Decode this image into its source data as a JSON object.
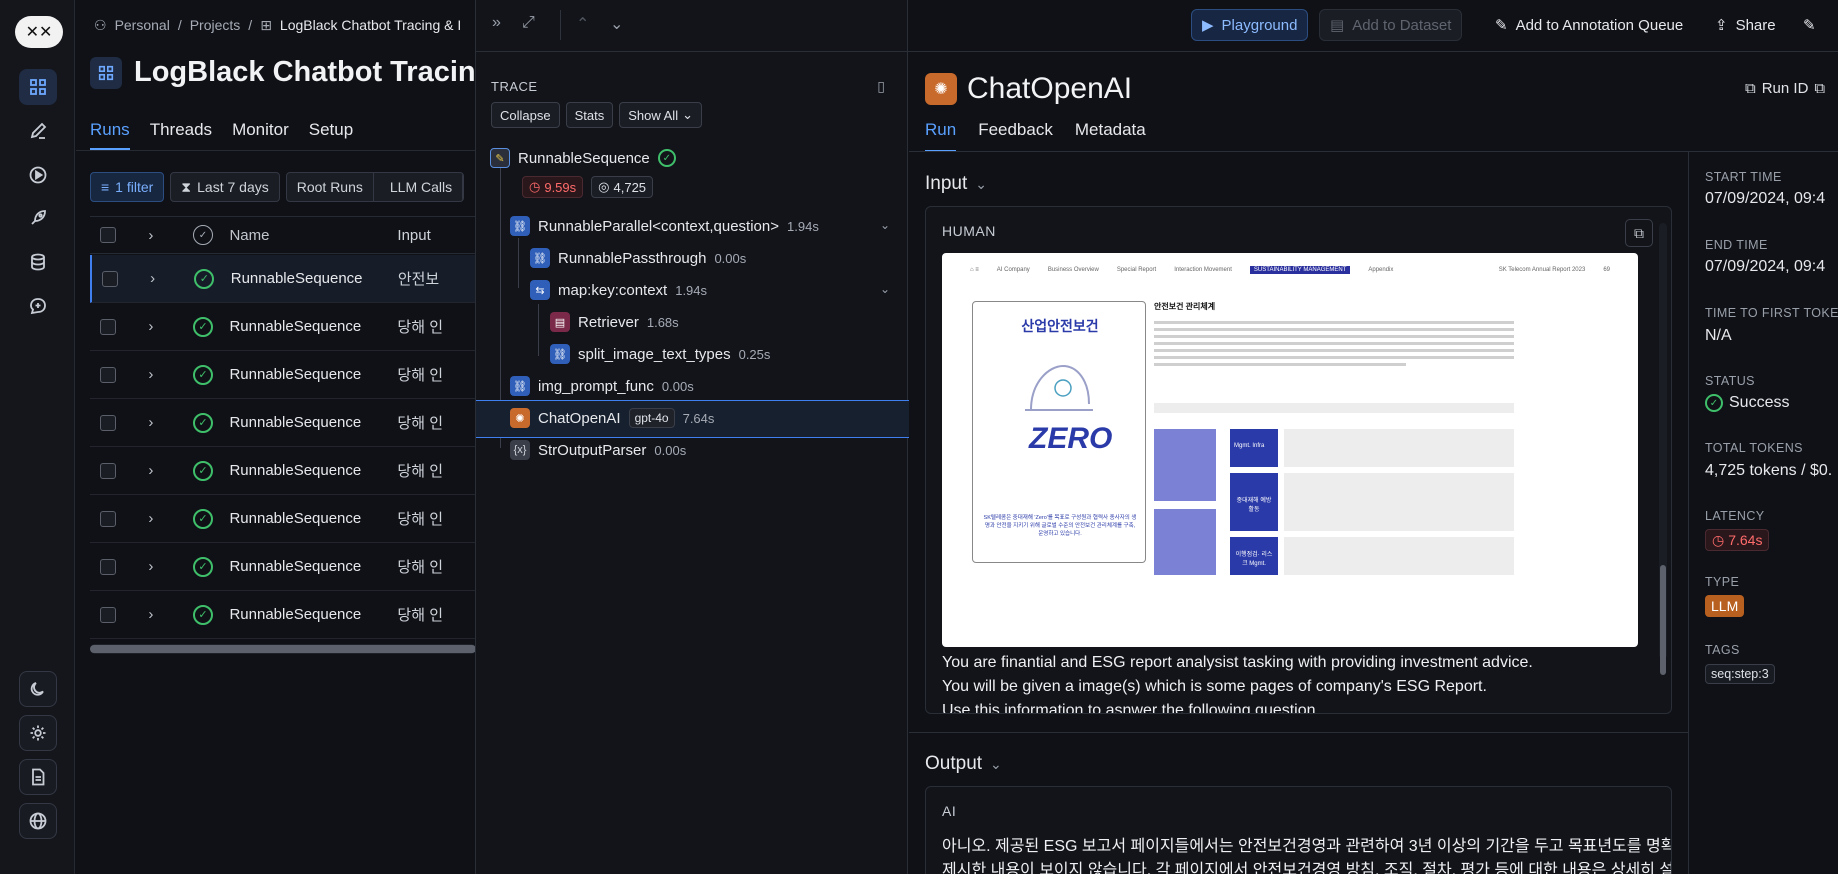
{
  "breadcrumb": {
    "personal": "Personal",
    "projects": "Projects",
    "current": "LogBlack Chatbot Tracing & I"
  },
  "page_title": "LogBlack Chatbot Tracin",
  "main_tabs": [
    "Runs",
    "Threads",
    "Monitor",
    "Setup"
  ],
  "filters": {
    "filter": "1 filter",
    "range": "Last 7 days",
    "root_runs": "Root Runs",
    "llm_calls": "LLM Calls"
  },
  "table": {
    "headers": {
      "name": "Name",
      "input": "Input"
    },
    "rows": [
      {
        "name": "RunnableSequence",
        "input": "안전보"
      },
      {
        "name": "RunnableSequence",
        "input": "당해 인"
      },
      {
        "name": "RunnableSequence",
        "input": "당해 인"
      },
      {
        "name": "RunnableSequence",
        "input": "당해 인"
      },
      {
        "name": "RunnableSequence",
        "input": "당해 인"
      },
      {
        "name": "RunnableSequence",
        "input": "당해 인"
      },
      {
        "name": "RunnableSequence",
        "input": "당해 인"
      },
      {
        "name": "RunnableSequence",
        "input": "당해 인"
      }
    ]
  },
  "trace": {
    "label": "TRACE",
    "buttons": {
      "collapse": "Collapse",
      "stats": "Stats",
      "show_all": "Show All"
    },
    "root": {
      "name": "RunnableSequence",
      "latency": "9.59s",
      "tokens": "4,725"
    },
    "nodes": [
      {
        "name": "RunnableParallel<context,question>",
        "dur": "1.94s"
      },
      {
        "name": "RunnablePassthrough",
        "dur": "0.00s"
      },
      {
        "name": "map:key:context",
        "dur": "1.94s"
      },
      {
        "name": "Retriever",
        "dur": "1.68s"
      },
      {
        "name": "split_image_text_types",
        "dur": "0.25s"
      },
      {
        "name": "img_prompt_func",
        "dur": "0.00s"
      },
      {
        "name": "ChatOpenAI",
        "model": "gpt-4o",
        "dur": "7.64s"
      },
      {
        "name": "StrOutputParser",
        "dur": "0.00s"
      }
    ]
  },
  "toolbar": {
    "playground": "Playground",
    "add_dataset": "Add to Dataset",
    "annotation": "Add to Annotation Queue",
    "share": "Share"
  },
  "detail": {
    "title": "ChatOpenAI",
    "run_id": "Run ID",
    "tabs": [
      "Run",
      "Feedback",
      "Metadata"
    ],
    "input_label": "Input",
    "output_label": "Output",
    "human_role": "HUMAN",
    "ai_role": "AI",
    "prompt_lines": [
      "You are finantial and ESG report analysist tasking with providing investment advice.",
      "You will be given a image(s) which is some pages of company's ESG Report.",
      "Use this information to asnwer the following question."
    ],
    "ai_lines": [
      "아니오. 제공된 ESG 보고서 페이지들에서는 안전보건경영과 관련하여 3년 이상의 기간을 두고 목표년도를 명확히",
      "제시한 내용이 보이지 않습니다. 각 페이지에서 안전보건경영 방침, 조직, 절차, 평가 등에 대한 내용은 상세히 설명되"
    ]
  },
  "doc_image": {
    "nav": [
      "AI Company",
      "Business Overview",
      "Special Report",
      "Interaction Movement",
      "SUSTAINABILITY MANAGEMENT",
      "Appendix"
    ],
    "report": "SK Telecom Annual Report 2023",
    "page": "69",
    "card_title": "산업안전보건",
    "zero": "ZERO",
    "heading": "안전보건 관리체계",
    "card_body": "SK텔레콤은 중대재해 'Zero'를 목표로 구성원과 협력사 종사자의 생명과 안전을 지키기 위해 글로벌 수준의 안전보건 관리체계를 구축, 운영하고 있습니다.",
    "boxes": [
      "Mgmt. Infra",
      "중대재해 예방 활동",
      "이행점검· 리스크 Mgmt."
    ]
  },
  "meta": {
    "start_time_label": "START TIME",
    "start_time": "07/09/2024, 09:4",
    "end_time_label": "END TIME",
    "end_time": "07/09/2024, 09:4",
    "ttft_label": "TIME TO FIRST TOKEN",
    "ttft": "N/A",
    "status_label": "STATUS",
    "status": "Success",
    "tokens_label": "TOTAL TOKENS",
    "tokens": "4,725 tokens / $0.",
    "latency_label": "LATENCY",
    "latency": "7.64s",
    "type_label": "TYPE",
    "type": "LLM",
    "tags_label": "TAGS",
    "tag": "seq:step:3"
  }
}
